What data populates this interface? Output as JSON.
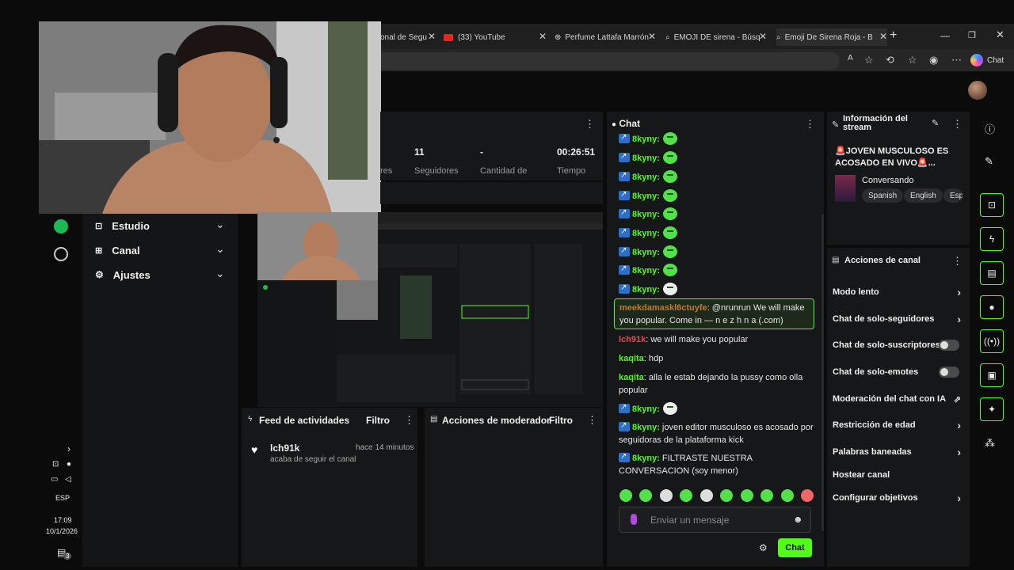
{
  "browser": {
    "tabs": [
      {
        "label": "onal de Segu"
      },
      {
        "label": "(33) YouTube"
      },
      {
        "label": "Perfume Lattafa Marrón"
      },
      {
        "label": "EMOJI DE sirena - Búsq"
      },
      {
        "label": "Emoji De Sirena Roja - B"
      }
    ],
    "chat_button": "Chat"
  },
  "sidebar": {
    "items": [
      {
        "label": "Estudio"
      },
      {
        "label": "Canal"
      },
      {
        "label": "Ajustes"
      }
    ]
  },
  "stats": {
    "items": [
      {
        "value": "",
        "label": "res"
      },
      {
        "value": "11",
        "label": "Seguidores"
      },
      {
        "value": "-",
        "label": "Cantidad de"
      },
      {
        "value": "00:26:51",
        "label": "Tiempo"
      }
    ]
  },
  "chat": {
    "title": "Chat",
    "messages": [
      {
        "user": "8kyny:",
        "text": "",
        "emote": true
      },
      {
        "user": "8kyny:",
        "text": "",
        "emote": true
      },
      {
        "user": "8kyny:",
        "text": "",
        "emote": true
      },
      {
        "user": "8kyny:",
        "text": "",
        "emote": true
      },
      {
        "user": "8kyny:",
        "text": "",
        "emote": true
      },
      {
        "user": "8kyny:",
        "text": "",
        "emote": true
      },
      {
        "user": "8kyny:",
        "text": "",
        "emote": true
      },
      {
        "user": "8kyny:",
        "text": "",
        "emote": true
      },
      {
        "user": "8kyny:",
        "text": "",
        "emote": true
      }
    ],
    "highlight": {
      "user": "meekdamaskl6ctuyfe",
      "text": ": @nrunrun We will make you popular. Come in —  n e z h n a (.com)"
    },
    "messages2": [
      {
        "user": "lch91k",
        "text": ": we will make you popular"
      },
      {
        "user": "kaqita",
        "text": ": hdp"
      },
      {
        "user": "kaqita",
        "text": ": alla le estab dejando la pussy como olla popular"
      },
      {
        "user": "8kyny:",
        "text": ""
      },
      {
        "user": "8kyny:",
        "text": " joven editor musculoso es acosado por seguidoras de la plataforma kick"
      },
      {
        "user": "8kyny:",
        "text": " FILTRASTE NUESTRA CONVERSACION (soy menor)"
      }
    ],
    "input_placeholder": "Enviar un mensaje",
    "send_label": "Chat"
  },
  "stream_info": {
    "title": "Información del stream",
    "stream_title": "🚨JOVEN MUSCULOSO ES ACOSADO EN VIVO🚨...",
    "category": "Conversando",
    "tags": [
      "Spanish",
      "English",
      "Esp"
    ]
  },
  "channel_actions": {
    "title": "Acciones de canal",
    "rows": [
      {
        "label": "Modo lento",
        "control": "arrow"
      },
      {
        "label": "Chat de solo-seguidores",
        "control": "arrow"
      },
      {
        "label": "Chat de solo-suscriptores",
        "control": "toggle"
      },
      {
        "label": "Chat de solo-emotes",
        "control": "toggle"
      },
      {
        "label": "Moderación del chat con IA",
        "control": "chart"
      },
      {
        "label": "Restricción de edad",
        "control": "arrow"
      },
      {
        "label": "Palabras baneadas",
        "control": "arrow"
      },
      {
        "label": "Hostear canal",
        "control": "none"
      },
      {
        "label": "Configurar objetivos",
        "control": "arrow"
      }
    ]
  },
  "feed": {
    "title": "Feed de actividades",
    "filter": "Filtro",
    "event_user": "lch91k",
    "event_time": "hace 14 minutos",
    "event_text": "acaba de seguir el canal"
  },
  "mod_actions": {
    "title": "Acciones de moderador",
    "filter": "Filtro"
  },
  "taskbar": {
    "lang": "ESP",
    "time": "17:09",
    "date": "10/1/2026",
    "notif_count": "3"
  },
  "colors": {
    "accent": "#53fc18",
    "panel": "#161718",
    "background": "#0b0b0c"
  }
}
